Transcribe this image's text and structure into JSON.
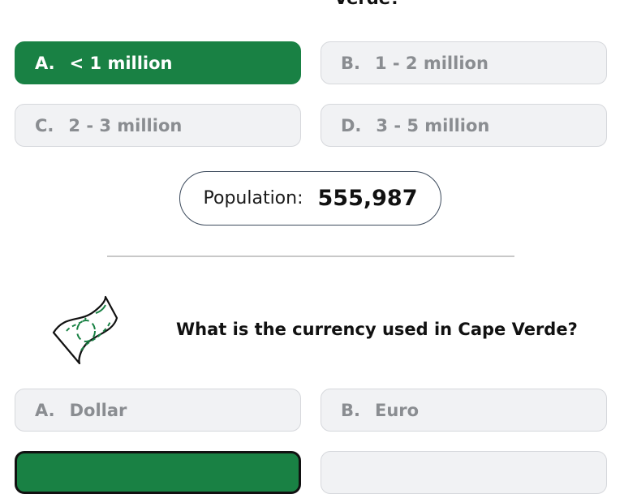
{
  "previous_question": {
    "partial_text": "Verde?"
  },
  "population_question": {
    "options": [
      {
        "letter": "A.",
        "label": "< 1 million",
        "selected": true
      },
      {
        "letter": "B.",
        "label": "1 - 2 million",
        "selected": false
      },
      {
        "letter": "C.",
        "label": "2 - 3 million",
        "selected": false
      },
      {
        "letter": "D.",
        "label": "3 - 5 million",
        "selected": false
      }
    ],
    "result": {
      "label": "Population:",
      "value": "555,987"
    }
  },
  "currency_question": {
    "icon": "money-bill-icon",
    "text": "What is the currency used in Cape Verde?",
    "options": [
      {
        "letter": "A.",
        "label": "Dollar",
        "selected": false
      },
      {
        "letter": "B.",
        "label": "Euro",
        "selected": false
      },
      {
        "letter": "",
        "label": "",
        "selected": true
      },
      {
        "letter": "",
        "label": "",
        "selected": false
      }
    ]
  },
  "colors": {
    "correct_green": "#198144",
    "option_bg": "#f1f2f4",
    "option_text": "#8a8d91"
  }
}
